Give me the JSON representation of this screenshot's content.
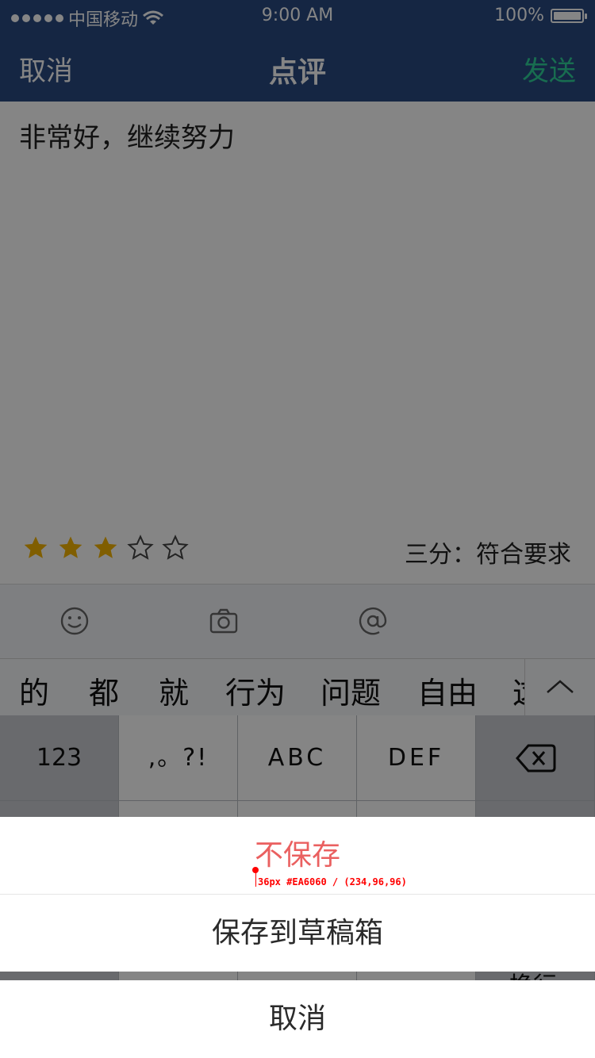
{
  "status_bar": {
    "carrier": "中国移动",
    "time": "9:00 AM",
    "battery": "100%",
    "battery_level": 1.0
  },
  "nav": {
    "left": "取消",
    "title": "点评",
    "right": "发送",
    "right_color": "#2fd19a"
  },
  "comment": {
    "text": "非常好，继续努力"
  },
  "rating": {
    "stars_filled": 3,
    "stars_total": 5,
    "label": "三分：符合要求",
    "star_color": "#f5b400"
  },
  "toolbar": {
    "icons": [
      "smiley-icon",
      "camera-icon",
      "at-icon"
    ]
  },
  "keyboard": {
    "candidates": [
      "的",
      "都",
      "就",
      "行为",
      "问题",
      "自由",
      "这"
    ],
    "keys": {
      "numbers": "123",
      "punct": ",。?!",
      "abc": "ABC",
      "def": "DEF"
    },
    "partial_key": "换行"
  },
  "action_sheet": {
    "discard": "不保存",
    "save_draft": "保存到草稿箱",
    "cancel": "取消",
    "discard_color": "#EA6060"
  },
  "annotation": {
    "text": "36px #EA6060 / (234,96,96)"
  }
}
